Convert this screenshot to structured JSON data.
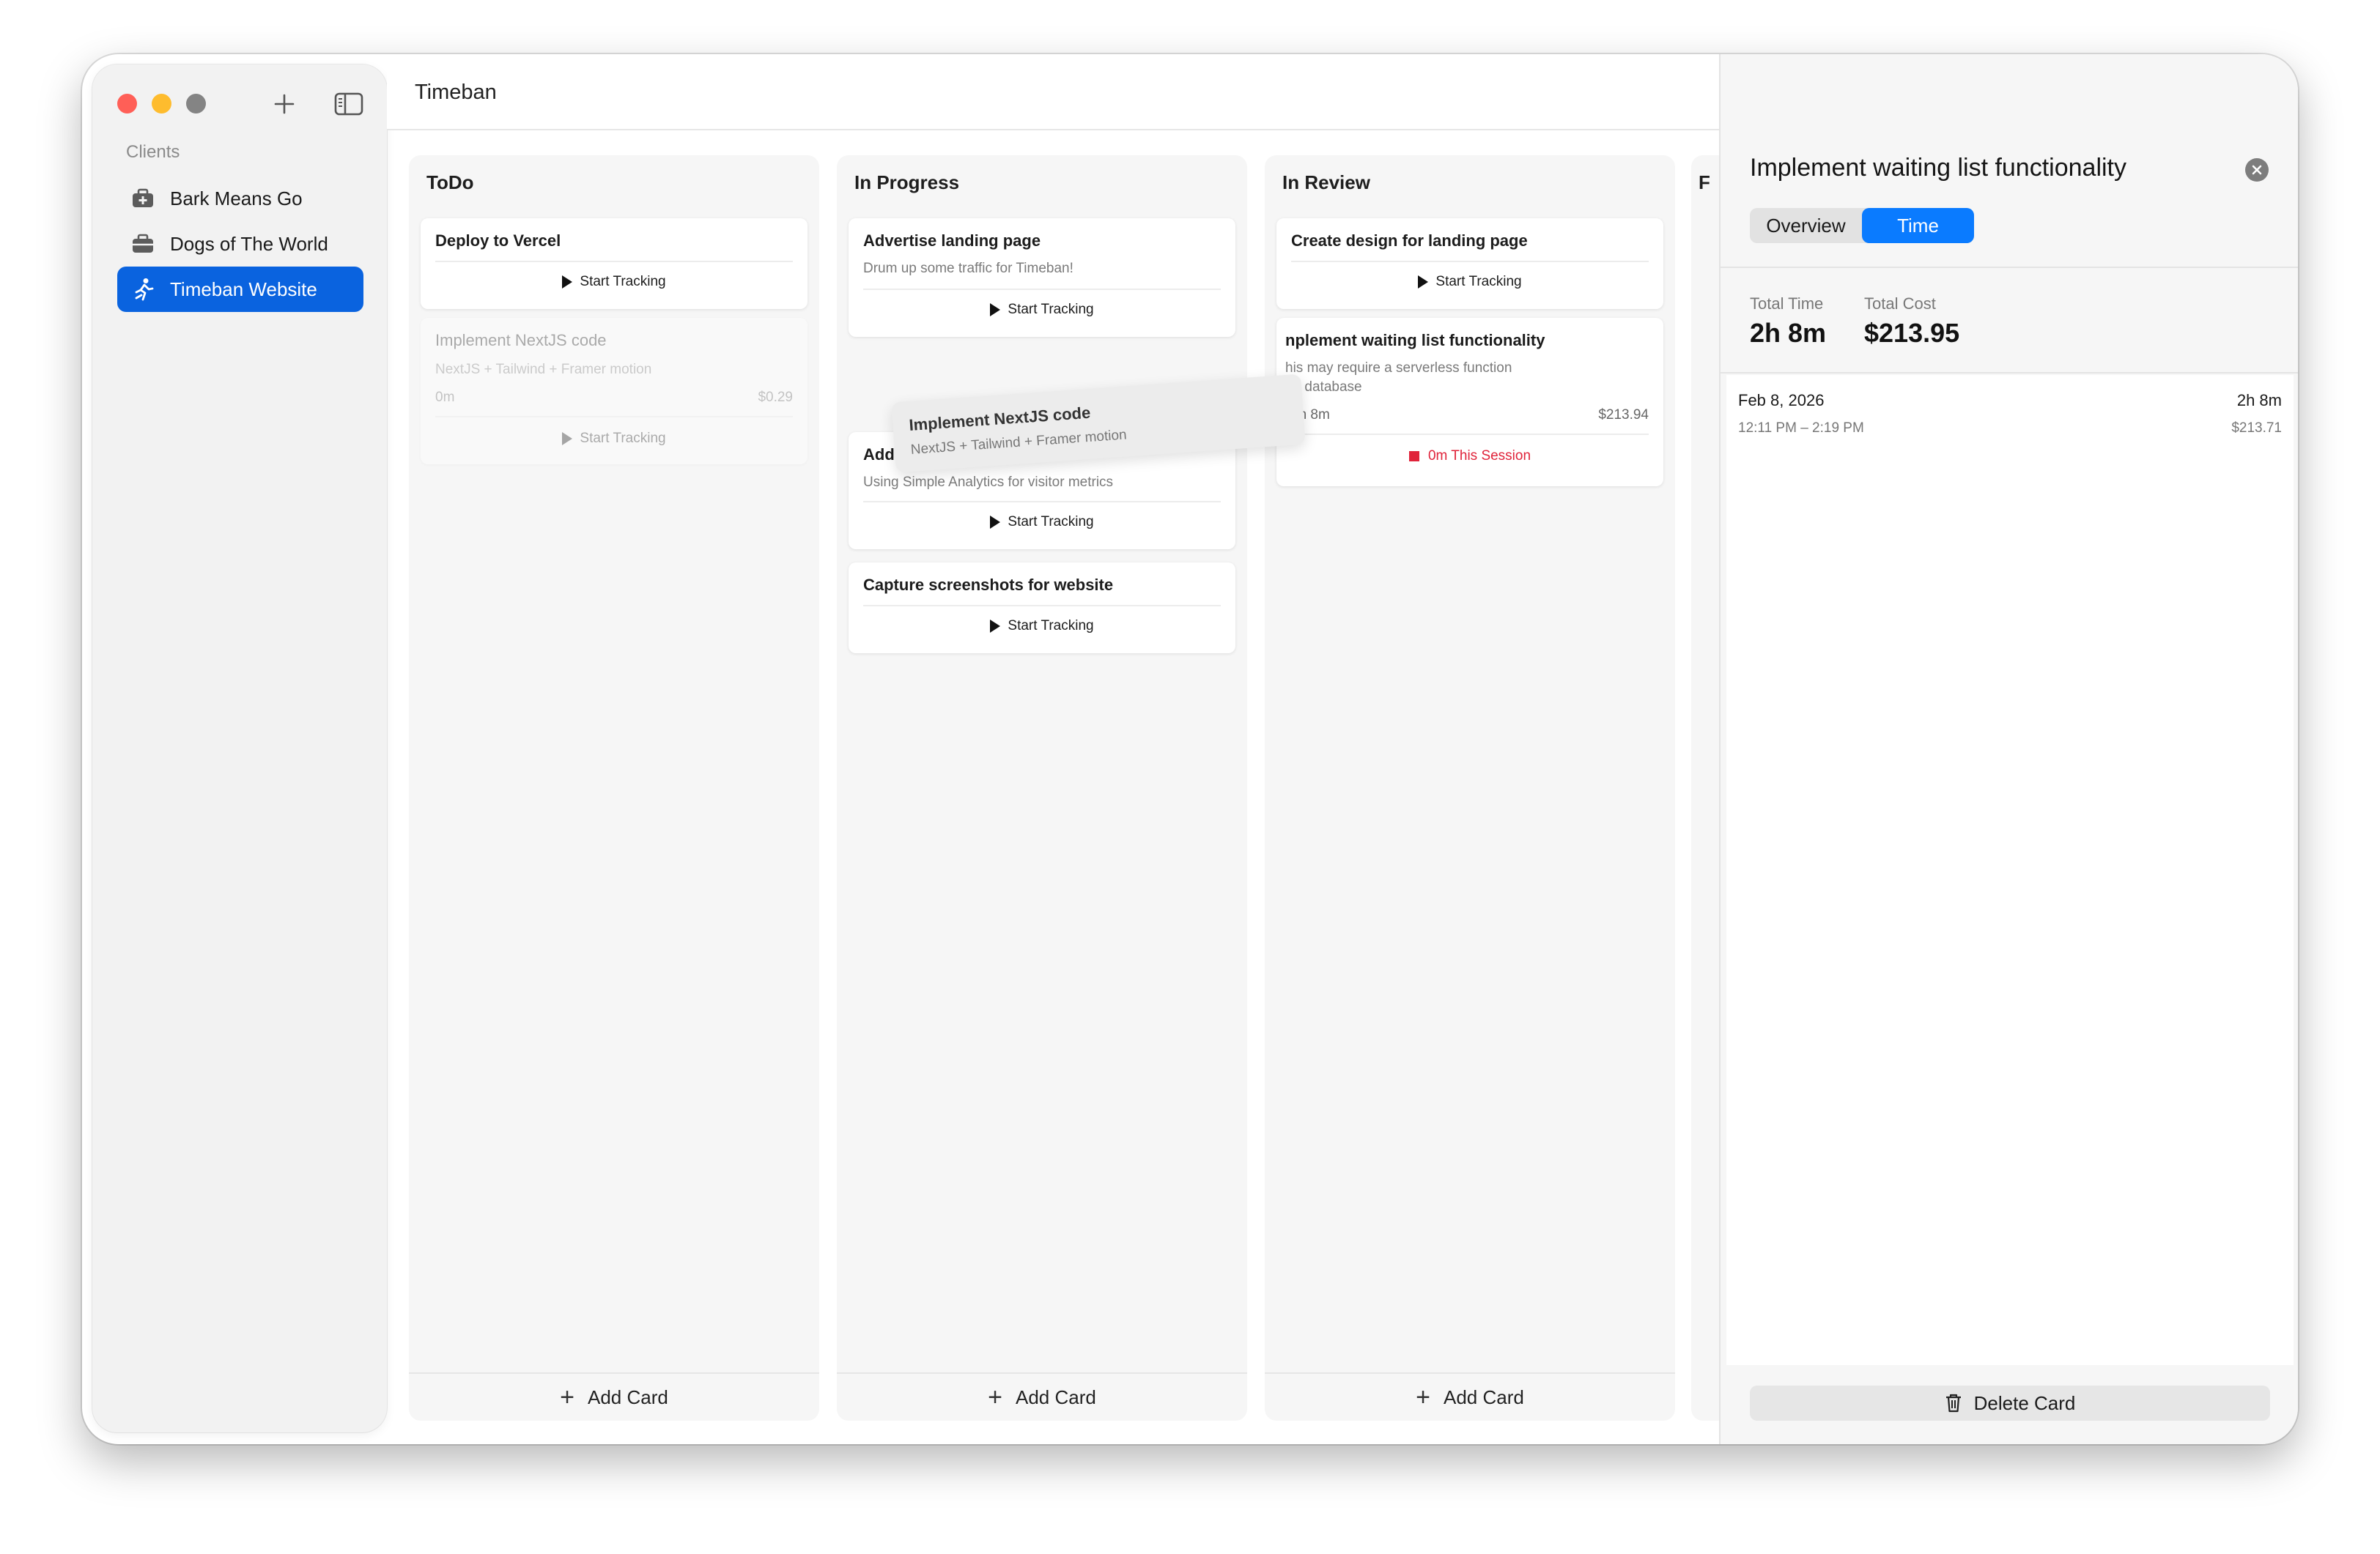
{
  "window": {
    "title": "Timeban"
  },
  "sidebar": {
    "heading": "Clients",
    "add_icon": "plus-icon",
    "toggle_icon": "sidebar-toggle-icon",
    "items": [
      {
        "label": "Bark Means Go",
        "icon": "medkit-icon"
      },
      {
        "label": "Dogs of The World",
        "icon": "briefcase-icon"
      },
      {
        "label": "Timeban Website",
        "icon": "runner-icon",
        "active": true
      }
    ]
  },
  "board": {
    "add_card_label": "Add Card",
    "start_tracking_label": "Start Tracking",
    "columns": [
      {
        "title": "ToDo",
        "cards": [
          {
            "title": "Deploy to Vercel"
          },
          {
            "title": "Implement NextJS code",
            "description": "NextJS + Tailwind + Framer motion",
            "time": "0m",
            "cost": "$0.29",
            "ghost": true
          }
        ]
      },
      {
        "title": "In Progress",
        "cards": [
          {
            "title": "Advertise landing page",
            "description": "Drum up some traffic for Timeban!"
          },
          {
            "title": "Add analytics",
            "description": "Using Simple Analytics for visitor metrics"
          },
          {
            "title": "Capture screenshots for website"
          }
        ]
      },
      {
        "title": "In Review",
        "cards": [
          {
            "title": "Create design for landing page"
          },
          {
            "title": "nplement waiting list functionality",
            "description_lines": [
              "his may require a serverless function",
              "nd database"
            ],
            "time": "2h 8m",
            "cost": "$213.94",
            "session": "0m This Session"
          }
        ]
      },
      {
        "title": "F"
      }
    ],
    "dragging_card": {
      "title": "Implement NextJS code",
      "description": "NextJS + Tailwind + Framer motion"
    }
  },
  "panel": {
    "title": "Implement waiting list functionality",
    "tabs": [
      "Overview",
      "Time"
    ],
    "active_tab": "Time",
    "total_time_label": "Total Time",
    "total_time": "2h 8m",
    "total_cost_label": "Total Cost",
    "total_cost": "$213.95",
    "entries": [
      {
        "date": "Feb 8, 2026",
        "duration": "2h 8m",
        "range": "12:11 PM – 2:19 PM",
        "cost": "$213.71"
      }
    ],
    "delete_label": "Delete Card"
  },
  "colors": {
    "accent": "#0a63df",
    "segment_active": "#0a7bff",
    "stop": "#e0233a"
  }
}
